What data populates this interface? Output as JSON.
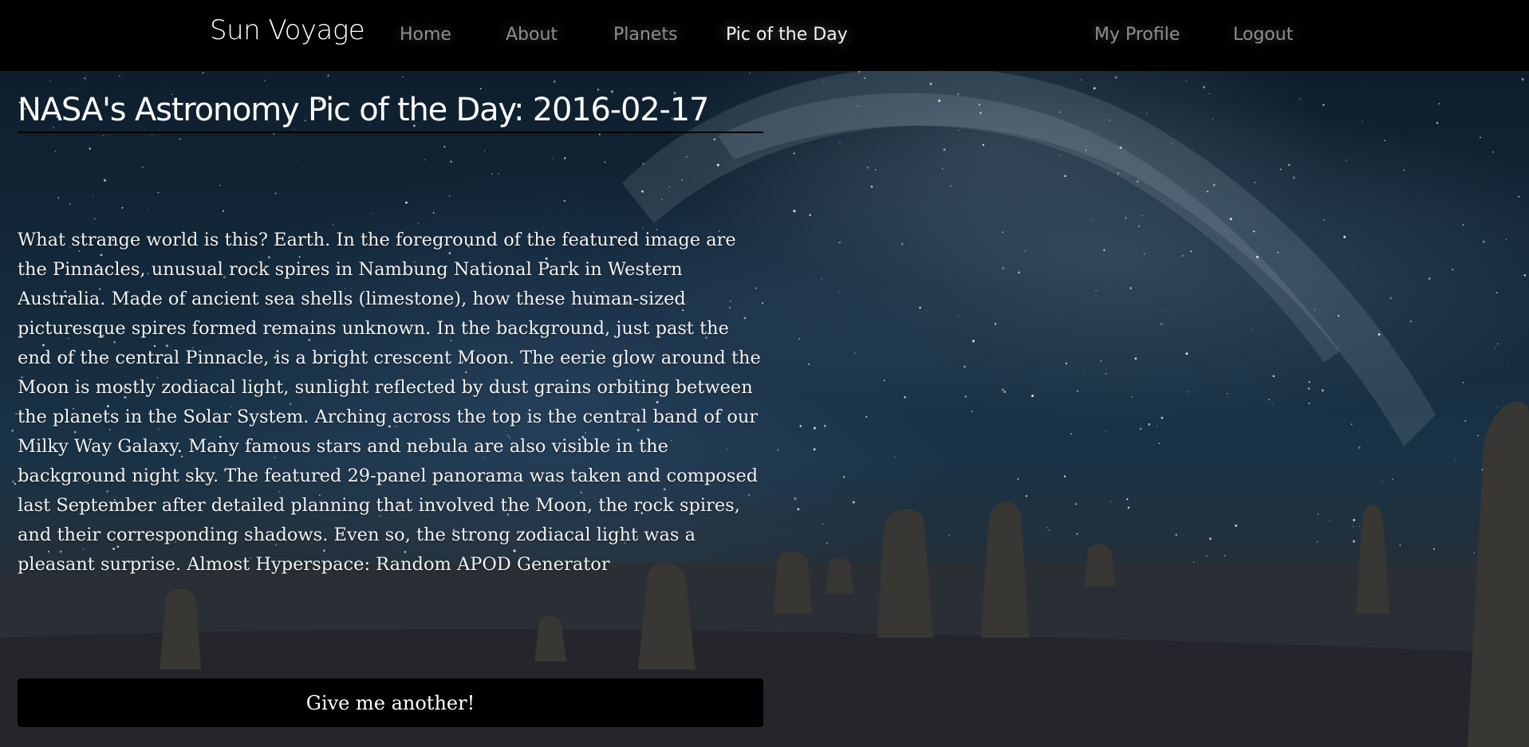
{
  "navbar": {
    "brand": "Sun Voyage",
    "links": [
      {
        "label": "Home",
        "active": false
      },
      {
        "label": "About",
        "active": false
      },
      {
        "label": "Planets",
        "active": false
      },
      {
        "label": "Pic of the Day",
        "active": true
      }
    ],
    "account_links": [
      {
        "label": "My Profile"
      },
      {
        "label": "Logout"
      }
    ]
  },
  "apod": {
    "title_prefix": "NASA's Astronomy Pic of the Day: ",
    "date": "2016-02-17",
    "description": "What strange world is this? Earth. In the foreground of the featured image are the Pinnacles, unusual rock spires in Nambung National Park in Western Australia. Made of ancient sea shells (limestone), how these human-sized picturesque spires formed remains unknown. In the background, just past the end of the central Pinnacle, is a bright crescent Moon. The eerie glow around the Moon is mostly zodiacal light, sunlight reflected by dust grains orbiting between the planets in the Solar System. Arching across the top is the central band of our Milky Way Galaxy. Many famous stars and nebula are also visible in the background night sky. The featured 29-panel panorama was taken and composed last September after detailed planning that involved the Moon, the rock spires, and their corresponding shadows. Even so, the strong zodiacal light was a pleasant surprise. Almost Hyperspace: Random APOD Generator",
    "button_label": "Give me another!"
  },
  "colors": {
    "navbar_bg": "#000000",
    "nav_link": "#8e8e8e",
    "nav_link_active": "#f2f2f2",
    "text": "#ffffff"
  }
}
